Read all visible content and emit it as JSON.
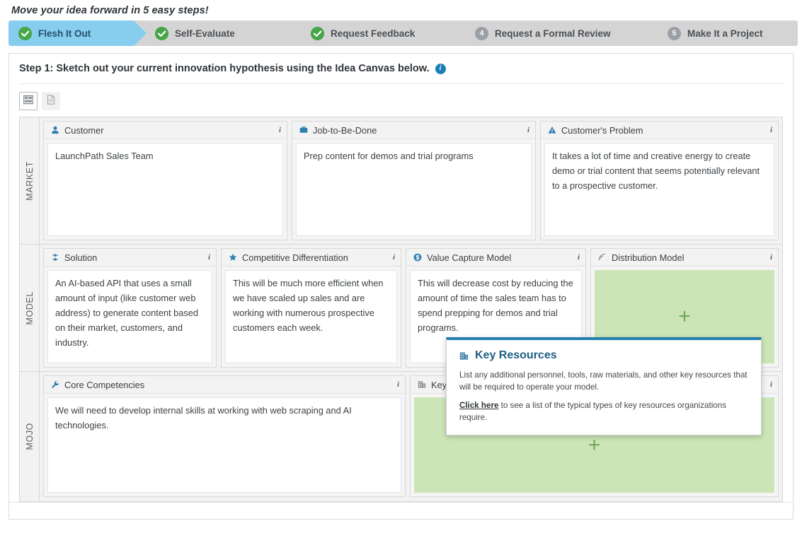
{
  "tagline": "Move your idea forward in 5 easy steps!",
  "steps": [
    {
      "id": "flesh-it-out",
      "label": "Flesh It Out",
      "state": "active",
      "badge": "check",
      "number": "1"
    },
    {
      "id": "self-evaluate",
      "label": "Self-Evaluate",
      "state": "done",
      "badge": "check",
      "number": "2"
    },
    {
      "id": "request-feedback",
      "label": "Request Feedback",
      "state": "done",
      "badge": "check",
      "number": "3"
    },
    {
      "id": "request-formal-review",
      "label": "Request a Formal Review",
      "state": "todo",
      "badge": "number",
      "number": "4"
    },
    {
      "id": "make-it-a-project",
      "label": "Make It a Project",
      "state": "todo",
      "badge": "number",
      "number": "5"
    }
  ],
  "panel": {
    "title": "Step 1: Sketch out your current innovation hypothesis using the Idea Canvas below.",
    "info_glyph": "i"
  },
  "toolbar": {
    "buttons": [
      {
        "name": "canvas-view",
        "icon": "grid-layout-icon",
        "selected": true
      },
      {
        "name": "text-view",
        "icon": "document-icon",
        "selected": false
      }
    ]
  },
  "canvas": {
    "rows": [
      {
        "label": "MARKET",
        "cards": [
          {
            "key": "customer",
            "title": "Customer",
            "icon": "person-icon",
            "info": "i",
            "text": "LaunchPath Sales Team",
            "empty": false
          },
          {
            "key": "job-to-be-done",
            "title": "Job-to-Be-Done",
            "icon": "briefcase-icon",
            "info": "i",
            "text": "Prep content for demos and trial programs",
            "empty": false
          },
          {
            "key": "customers-problem",
            "title": "Customer's Problem",
            "icon": "warning-triangle-icon",
            "info": "i",
            "text": "It takes a lot of time and creative energy to create demo or trial content that seems potentially relevant to a prospective customer.",
            "empty": false
          }
        ]
      },
      {
        "label": "MODEL",
        "cards": [
          {
            "key": "solution",
            "title": "Solution",
            "icon": "puzzle-icon",
            "info": "i",
            "text": "An AI-based API that uses a small amount of input (like customer web address) to generate content based on their market, customers, and industry.",
            "empty": false
          },
          {
            "key": "competitive-differentiation",
            "title": "Competitive Differentiation",
            "icon": "star-icon",
            "info": "i",
            "text": "This will be much more efficient when we have scaled up sales and are working with numerous prospective customers each week.",
            "empty": false
          },
          {
            "key": "value-capture-model",
            "title": "Value Capture Model",
            "icon": "dollar-circle-icon",
            "info": "i",
            "text": "This will decrease cost by reducing the amount of time the sales team has to spend prepping for demos and trial programs.",
            "empty": false
          },
          {
            "key": "distribution-model",
            "title": "Distribution Model",
            "icon": "rss-icon",
            "info": "i",
            "text": "",
            "empty": true,
            "add_glyph": "+"
          }
        ]
      },
      {
        "label": "MOJO",
        "cards": [
          {
            "key": "core-competencies",
            "title": "Core Competencies",
            "icon": "wrench-icon",
            "info": "i",
            "text": "We will need to develop internal skills at working with web scraping and AI technologies.",
            "empty": false
          },
          {
            "key": "key-resources",
            "title": "Key Resources",
            "icon": "building-icon",
            "info": "i",
            "text": "",
            "empty": true,
            "add_glyph": "+"
          }
        ]
      }
    ]
  },
  "popover": {
    "icon": "building-icon",
    "title": "Key Resources",
    "paragraph1": "List any additional personnel, tools, raw materials, and other key resources that will be required to operate your model.",
    "link_text": "Click here",
    "paragraph2_rest": " to see a list of the typical types of key resources organizations require."
  },
  "colors": {
    "active_step": "#87cdee",
    "inactive_step": "#d4d4d4",
    "done_badge": "#48a548",
    "todo_badge": "#9aa0a5",
    "icon_blue": "#2e7fae",
    "empty_zone_green": "#cce5b6",
    "plus_green": "#6fa85a",
    "popover_accent": "#2280ab",
    "popover_title": "#1d5f82",
    "info_badge_blue": "#1b7eb5"
  }
}
